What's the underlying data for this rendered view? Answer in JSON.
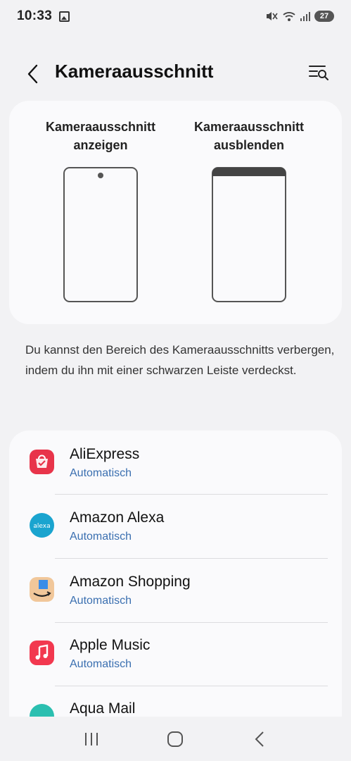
{
  "status_bar": {
    "time": "10:33",
    "battery": "27",
    "icons": [
      "gallery-icon",
      "mute-icon",
      "wifi-icon",
      "signal-icon",
      "battery-icon"
    ]
  },
  "header": {
    "title": "Kameraausschnitt",
    "back_icon": "chevron-left-icon",
    "action_icon": "search-settings-icon"
  },
  "preview": {
    "options": [
      {
        "label": "Kameraausschnitt\nanzeigen",
        "style": "camera-cutout-visible"
      },
      {
        "label": "Kameraausschnitt\nausblenden",
        "style": "camera-cutout-hidden-black-bar"
      }
    ]
  },
  "description": "Du kannst den Bereich des Kameraausschnitts verbergen, indem du ihn mit einer schwarzen Leiste verdeckst.",
  "apps": [
    {
      "name": "AliExpress",
      "status": "Automatisch",
      "icon": "aliexpress-icon",
      "color": "#e8344a"
    },
    {
      "name": "Amazon Alexa",
      "status": "Automatisch",
      "icon": "alexa-icon",
      "color": "#1aa4cf"
    },
    {
      "name": "Amazon Shopping",
      "status": "Automatisch",
      "icon": "amazon-shopping-icon",
      "color": "#f1c79a"
    },
    {
      "name": "Apple Music",
      "status": "Automatisch",
      "icon": "apple-music-icon",
      "color": "#f2384f"
    },
    {
      "name": "Aqua Mail",
      "status": "",
      "icon": "aqua-mail-icon",
      "color": "#2bbfb0"
    }
  ],
  "nav_bar": {
    "icons": [
      "recent-apps-icon",
      "home-icon",
      "back-icon"
    ]
  }
}
